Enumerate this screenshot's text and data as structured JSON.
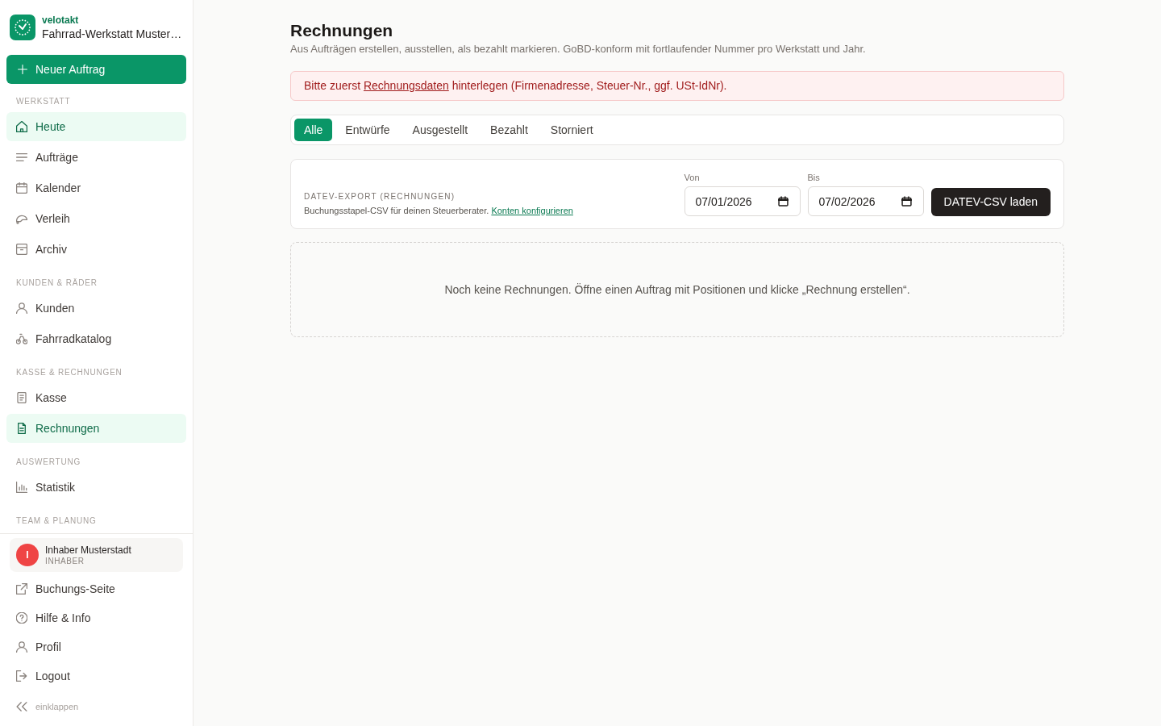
{
  "brand": {
    "name": "velotakt",
    "workshop": "Fahrrad-Werkstatt Muster…"
  },
  "new_order_button": {
    "label": "Neuer Auftrag"
  },
  "nav_sections": [
    {
      "title": "WERKSTATT",
      "items": [
        {
          "label": "Heute",
          "selected": true
        },
        {
          "label": "Aufträge",
          "selected": false
        },
        {
          "label": "Kalender",
          "selected": false
        },
        {
          "label": "Verleih",
          "selected": false
        },
        {
          "label": "Archiv",
          "selected": false
        }
      ]
    },
    {
      "title": "KUNDEN & RÄDER",
      "items": [
        {
          "label": "Kunden",
          "selected": false
        },
        {
          "label": "Fahrradkatalog",
          "selected": false
        }
      ]
    },
    {
      "title": "KASSE & RECHNUNGEN",
      "items": [
        {
          "label": "Kasse",
          "selected": false
        },
        {
          "label": "Rechnungen",
          "selected": true
        }
      ]
    },
    {
      "title": "AUSWERTUNG",
      "items": [
        {
          "label": "Statistik",
          "selected": false
        }
      ]
    },
    {
      "title": "TEAM & PLANUNG"
    }
  ],
  "user": {
    "initial": "I",
    "name": "Inhaber Musterstadt",
    "role": "INHABER"
  },
  "footer_links": [
    "Buchungs-Seite",
    "Hilfe & Info",
    "Profil",
    "Logout"
  ],
  "collapse_link": "einklappen",
  "page": {
    "title": "Rechnungen",
    "subtitle": "Aus Aufträgen erstellen, ausstellen, als bezahlt markieren. GoBD-konform mit fortlaufender Nummer pro Werkstatt und Jahr."
  },
  "alert": {
    "before": "Bitte zuerst ",
    "link": "Rechnungsdaten",
    "after": " hinterlegen (Firmenadresse, Steuer-Nr., ggf. USt-IdNr)."
  },
  "tabs": [
    {
      "label": "Alle",
      "selected": true
    },
    {
      "label": "Entwürfe",
      "selected": false
    },
    {
      "label": "Ausgestellt",
      "selected": false
    },
    {
      "label": "Bezahlt",
      "selected": false
    },
    {
      "label": "Storniert",
      "selected": false
    }
  ],
  "datev_export": {
    "label": "DATEV-EXPORT (RECHNUNGEN)",
    "description": "Buchungsstapel-CSV für deinen Steuerberater.",
    "link": "Konten konfigurieren",
    "from": {
      "label": "Von",
      "value": "07/01/2026"
    },
    "to": {
      "label": "Bis",
      "value": "07/02/2026"
    },
    "button": "DATEV-CSV laden"
  },
  "empty_state": "Noch keine Rechnungen. Öffne einen Auftrag mit Positionen und klicke „Rechnung erstellen“."
}
